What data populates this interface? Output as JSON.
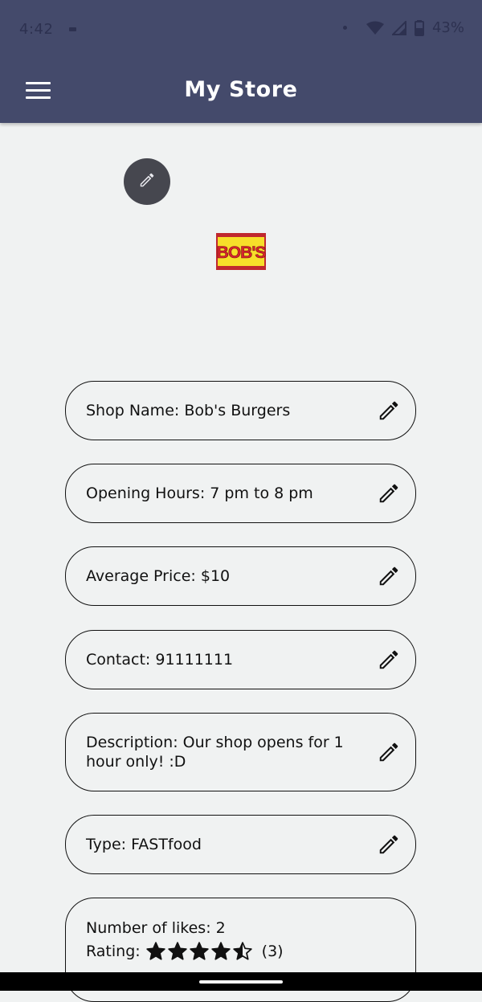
{
  "status_bar": {
    "time": "4:42",
    "battery": "43%"
  },
  "app_bar": {
    "title": "My Store",
    "menu_icon": "menu-icon"
  },
  "logo": {
    "text": "BOB'S",
    "colors": {
      "border": "#c0282f",
      "background": "#f7df2a",
      "text": "#d8242c"
    }
  },
  "edit_logo_icon": "pencil-icon",
  "fields": [
    {
      "text": "Shop Name: Bob's Burgers"
    },
    {
      "text": "Opening Hours: 7 pm to 8 pm"
    },
    {
      "text": "Average Price: $10"
    },
    {
      "text": "Contact: 91111111"
    },
    {
      "text": "Description: Our shop opens for 1 hour only! :D"
    },
    {
      "text": "Type: FASTfood"
    }
  ],
  "stats": {
    "likes_label": "Number of likes: 2",
    "rating_label": "Rating:",
    "rating_value": 4.5,
    "rating_max": 5,
    "rating_count": "(3)"
  },
  "colors": {
    "app_bar": "#444a6b",
    "background": "#f0f2f2",
    "fab": "#46474f"
  }
}
